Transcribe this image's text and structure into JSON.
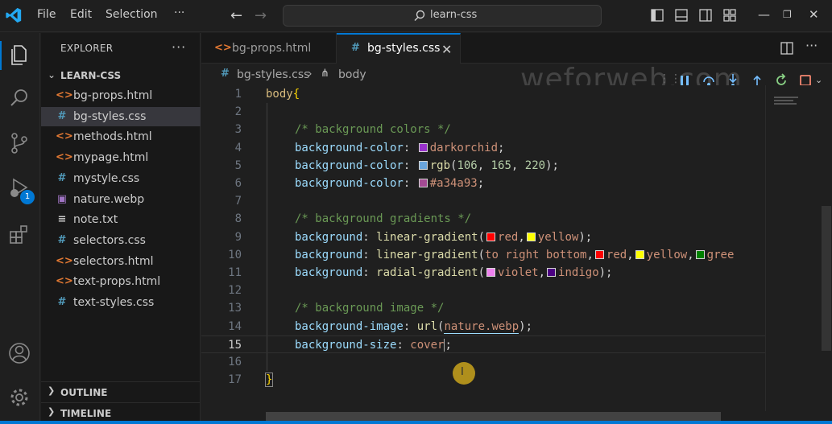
{
  "menu": {
    "file": "File",
    "edit": "Edit",
    "selection": "Selection",
    "more": "···"
  },
  "command_center": {
    "text": "learn-css"
  },
  "explorer": {
    "title": "EXPLORER",
    "more": "···",
    "folder": "LEARN-CSS",
    "files": [
      {
        "label": "bg-props.html",
        "type": "html"
      },
      {
        "label": "bg-styles.css",
        "type": "css"
      },
      {
        "label": "methods.html",
        "type": "html"
      },
      {
        "label": "mypage.html",
        "type": "html"
      },
      {
        "label": "mystyle.css",
        "type": "css"
      },
      {
        "label": "nature.webp",
        "type": "image"
      },
      {
        "label": "note.txt",
        "type": "txt"
      },
      {
        "label": "selectors.css",
        "type": "css"
      },
      {
        "label": "selectors.html",
        "type": "html"
      },
      {
        "label": "text-props.html",
        "type": "html"
      },
      {
        "label": "text-styles.css",
        "type": "css"
      }
    ],
    "outline": "OUTLINE",
    "timeline": "TIMELINE"
  },
  "activity": {
    "debug_badge": "1"
  },
  "tabs": [
    {
      "label": "bg-props.html",
      "icon": "<>"
    },
    {
      "label": "bg-styles.css",
      "icon": "#"
    }
  ],
  "breadcrumb": {
    "file": "bg-styles.css",
    "symbol": "body"
  },
  "watermark": "weforweb.com",
  "editor": {
    "line_numbers": [
      "1",
      "2",
      "3",
      "4",
      "5",
      "6",
      "7",
      "8",
      "9",
      "10",
      "11",
      "12",
      "13",
      "14",
      "15",
      "16",
      "17"
    ],
    "current_line": 15,
    "code": {
      "l1_sel": "body",
      "l1_brace": "{",
      "l3_cmt": "/* background colors */",
      "l4_prop": "background-color",
      "l4_val": "darkorchid",
      "l5_prop": "background-color",
      "l5_fn": "rgb",
      "l5_n1": "106",
      "l5_n2": "165",
      "l5_n3": "220",
      "l6_prop": "background-color",
      "l6_val": "#a34a93",
      "l8_cmt": "/* background gradients */",
      "l9_prop": "background",
      "l9_fn": "linear-gradient",
      "l9_v1": "red",
      "l9_v2": "yellow",
      "l10_prop": "background",
      "l10_fn": "linear-gradient",
      "l10_dir": "to right bottom",
      "l10_v1": "red",
      "l10_v2": "yellow",
      "l10_v3": "gree",
      "l11_prop": "background",
      "l11_fn": "radial-gradient",
      "l11_v1": "violet",
      "l11_v2": "indigo",
      "l13_cmt": "/* background image */",
      "l14_prop": "background-image",
      "l14_fn": "url",
      "l14_arg": "nature.webp",
      "l15_prop": "background-size",
      "l15_val": "cover",
      "l17_brace": "}"
    },
    "swatches": {
      "darkorchid": "#9932cc",
      "rgb": "#6aa5dc",
      "hex": "#a34a93",
      "red": "#ff0000",
      "yellow": "#ffff00",
      "green": "#008000",
      "violet": "#ee82ee",
      "indigo": "#4b0082"
    }
  },
  "colors": {
    "accent": "#0078d4",
    "background": "#1f1f1f",
    "sidebar": "#181818"
  }
}
